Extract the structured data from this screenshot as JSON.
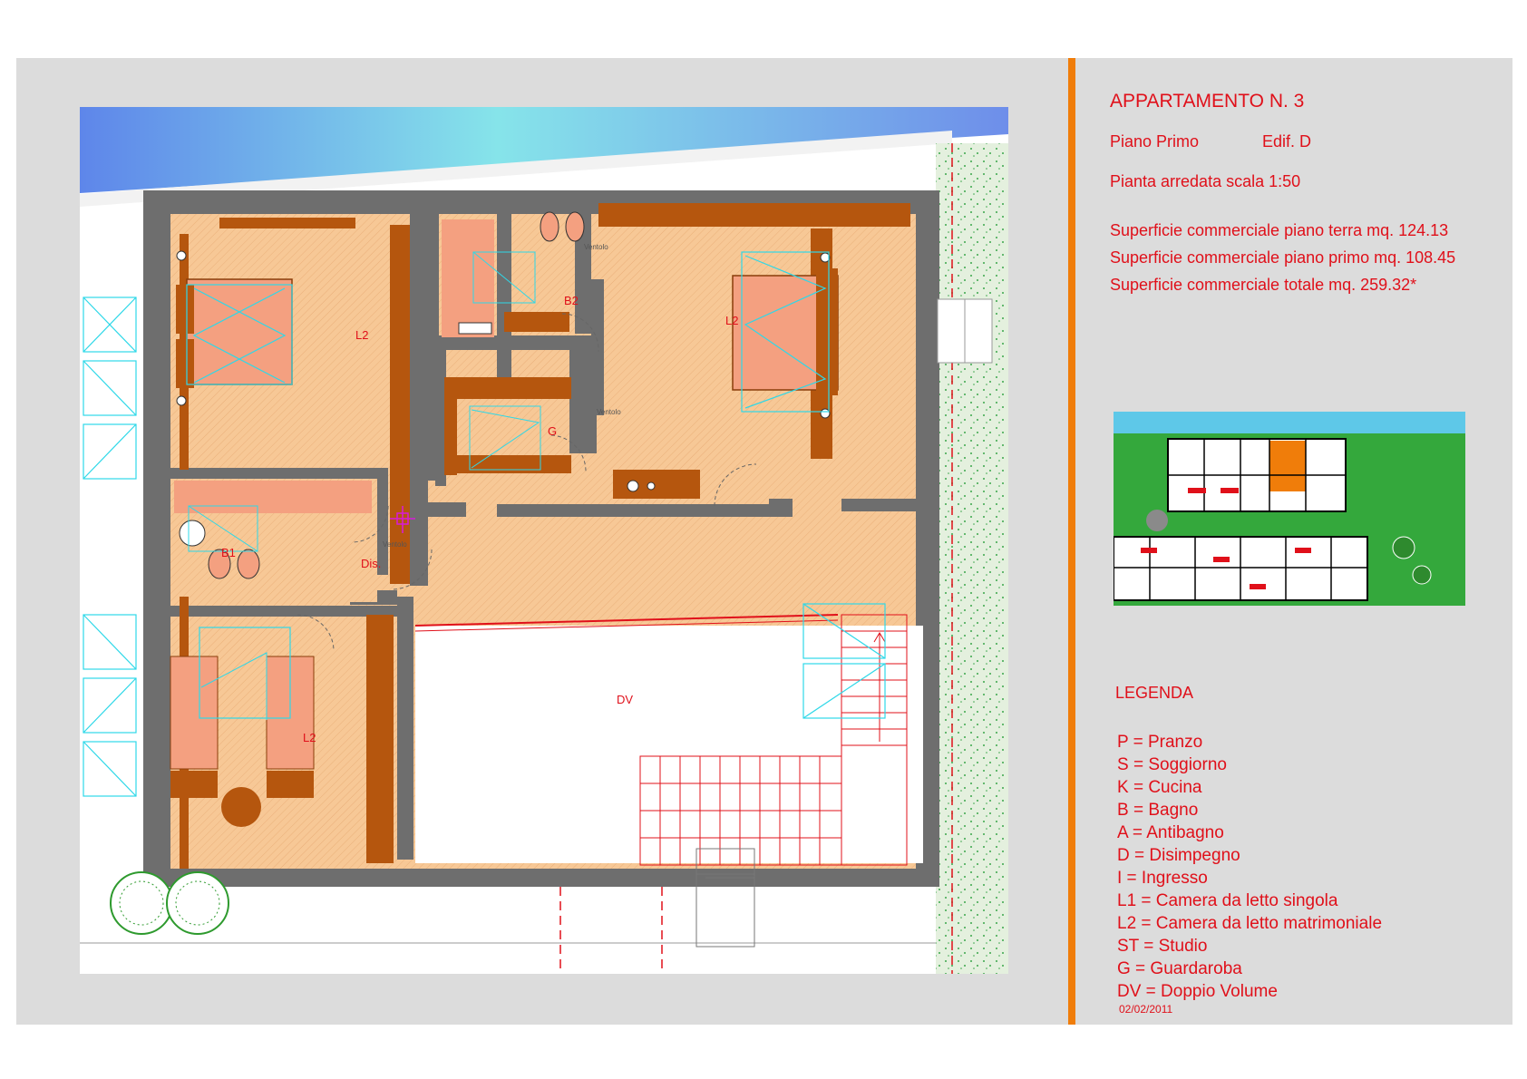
{
  "header": {
    "title": "APPARTAMENTO N. 3",
    "floor": "Piano Primo",
    "building": "Edif. D",
    "plan_type": "Pianta arredata scala 1:50"
  },
  "surfaces": [
    "Superficie commerciale piano terra mq. 124.13",
    "Superficie commerciale piano primo mq. 108.45",
    "Superficie commerciale totale mq. 259.32*"
  ],
  "legend": {
    "title": "LEGENDA",
    "items": [
      "P = Pranzo",
      "S = Soggiorno",
      "K = Cucina",
      "B = Bagno",
      "A = Antibagno",
      "D = Disimpegno",
      "I = Ingresso",
      "L1 = Camera da letto singola",
      "L2 = Camera da letto matrimoniale",
      "ST = Studio",
      "G = Guardaroba",
      "DV = Doppio Volume"
    ]
  },
  "date": "02/02/2011",
  "rooms": {
    "bedroom_nw": "L2",
    "bedroom_ne": "L2",
    "bedroom_sw": "L2",
    "bath_1": "B1",
    "bath_2": "B2",
    "wardrobe": "G",
    "hall": "Dis.",
    "double_volume": "DV"
  },
  "vent_label": "Ventolo",
  "colors": {
    "accent": "#f07d0a",
    "text": "#e0101a",
    "wall": "#6e6e6e",
    "floor": "#f7c896",
    "furniture": "#b5560e",
    "bath_floor": "#f4a080",
    "water": "#5ec8e8",
    "garden": "#2ea838"
  }
}
